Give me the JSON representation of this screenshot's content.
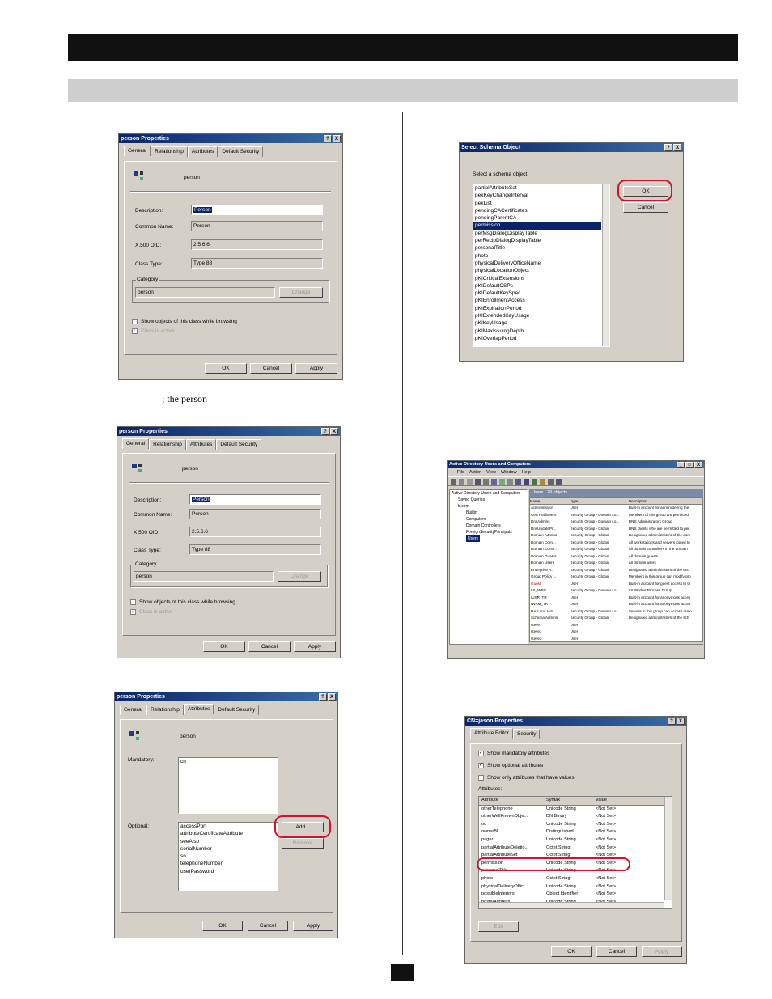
{
  "caption": "; the person",
  "dialog1": {
    "title": "person Properties",
    "title_buttons": [
      "?",
      "X"
    ],
    "tabs": [
      "General",
      "Relationship",
      "Attributes",
      "Default Security"
    ],
    "class_name": "person",
    "description_label": "Description:",
    "description_value": "Person",
    "common_name_label": "Common Name:",
    "common_name_value": "Person",
    "oid_label": "X.500 OID:",
    "oid_value": "2.5.6.6",
    "class_type_label": "Class Type:",
    "class_type_value": "Type 88",
    "category_label": "Category",
    "category_value": "person",
    "change_label": "Change",
    "show_objects_label": "Show objects of this class while browsing",
    "class_active_label": "Class is active",
    "ok_label": "OK",
    "cancel_label": "Cancel",
    "apply_label": "Apply"
  },
  "dialog3": {
    "title": "person Properties",
    "title_buttons": [
      "?",
      "X"
    ],
    "tabs": [
      "General",
      "Relationship",
      "Attributes",
      "Default Security"
    ],
    "class_name": "person",
    "mandatory_label": "Mandatory:",
    "mandatory_items": [
      "cn"
    ],
    "optional_label": "Optional:",
    "optional_items": [
      "accessPort",
      "attributeCertificateAttribute",
      "seeAlso",
      "serialNumber",
      "sn",
      "telephoneNumber",
      "userPassword"
    ],
    "add_label": "Add...",
    "remove_label": "Remove",
    "ok_label": "OK",
    "cancel_label": "Cancel",
    "apply_label": "Apply"
  },
  "schema_dialog": {
    "title": "Select Schema Object",
    "title_buttons": [
      "?",
      "X"
    ],
    "prompt": "Select a schema object:",
    "items": [
      "partialAttributeSet",
      "pekKeyChangeInterval",
      "pekList",
      "pendingCACertificates",
      "pendingParentCA",
      "permission",
      "perMsgDialogDisplayTable",
      "perRecipDialogDisplayTable",
      "personalTitle",
      "photo",
      "physicalDeliveryOfficeName",
      "physicalLocationObject",
      "pKICriticalExtensions",
      "pKIDefaultCSPs",
      "pKIDefaultKeySpec",
      "pKIEnrollmentAccess",
      "pKIExpirationPeriod",
      "pKIExtendedKeyUsage",
      "pKIKeyUsage",
      "pKIMaxIssuingDepth",
      "pKIOverlapPeriod"
    ],
    "selected": "permission",
    "ok_label": "OK",
    "cancel_label": "Cancel"
  },
  "aduc": {
    "title": "Active Directory Users and Computers",
    "title_buttons": [
      "_",
      "□",
      "X"
    ],
    "menu": [
      "File",
      "Action",
      "View",
      "Window",
      "Help"
    ],
    "tree": [
      "Active Directory Users and Computers",
      "Saved Queries",
      "tr.com",
      "Builtin",
      "Computers",
      "Domain Controllers",
      "ForeignSecurityPrincipals",
      "Users"
    ],
    "pane_header": "Users",
    "pane_count": "28 objects",
    "columns": [
      "Name",
      "Type",
      "Description"
    ],
    "rows": [
      [
        "Administrator",
        "User",
        "Built-in account for administering the"
      ],
      [
        "Cert Publishers",
        "Security Group - Domain Lo...",
        "Members of this group are permitted"
      ],
      [
        "DnsAdmins",
        "Security Group - Domain Lo...",
        "DNS Administrators Group"
      ],
      [
        "DnsUpdatePr...",
        "Security Group - Global",
        "DNS clients who are permitted to per"
      ],
      [
        "Domain Admins",
        "Security Group - Global",
        "Designated administrators of the dom"
      ],
      [
        "Domain Com...",
        "Security Group - Global",
        "All workstations and servers joined to"
      ],
      [
        "Domain Contr...",
        "Security Group - Global",
        "All domain controllers in the domain"
      ],
      [
        "Domain Guests",
        "Security Group - Global",
        "All domain guests"
      ],
      [
        "Domain Users",
        "Security Group - Global",
        "All domain users"
      ],
      [
        "Enterprise A...",
        "Security Group - Global",
        "Designated administrators of the ent"
      ],
      [
        "Group Policy ...",
        "Security Group - Global",
        "Members in this group can modify gro"
      ],
      [
        "Guest",
        "User",
        "Built-in account for guest access to th"
      ],
      [
        "IIS_WPG",
        "Security Group - Domain Lo...",
        "IIS Worker Process Group"
      ],
      [
        "IUSR_TR",
        "User",
        "Built-in account for anonymous acces"
      ],
      [
        "IWAM_TR",
        "User",
        "Built-in account for anonymous acces"
      ],
      [
        "RAS and IAS ...",
        "Security Group - Domain Lo...",
        "Servers in this group can access remo"
      ],
      [
        "Schema Admins",
        "Security Group - Global",
        "Designated administrators of the sch"
      ],
      [
        "steve",
        "User",
        ""
      ],
      [
        "steve1",
        "User",
        ""
      ],
      [
        "steve2",
        "User",
        ""
      ]
    ]
  },
  "jason": {
    "title": "CN=jason Properties",
    "title_buttons": [
      "?",
      "X"
    ],
    "tabs": [
      "Attribute Editor",
      "Security"
    ],
    "show_mandatory": "Show mandatory attributes",
    "show_optional": "Show optional attributes",
    "show_only_values": "Show only attributes that have values",
    "attributes_label": "Attributes:",
    "columns": [
      "Attribute",
      "Syntax",
      "Value"
    ],
    "rows": [
      [
        "otherTelephone",
        "Unicode String",
        "<Not Set>"
      ],
      [
        "otherWellKnownObje...",
        "DN Binary",
        "<Not Set>"
      ],
      [
        "ou",
        "Unicode String",
        "<Not Set>"
      ],
      [
        "ownerBL",
        "Distinguished ...",
        "<Not Set>"
      ],
      [
        "pager",
        "Unicode String",
        "<Not Set>"
      ],
      [
        "partialAttributeDeletio...",
        "Octet String",
        "<Not Set>"
      ],
      [
        "partialAttributeSet",
        "Octet String",
        "<Not Set>"
      ],
      [
        "permission",
        "Unicode String",
        "<Not Set>"
      ],
      [
        "personalTitle",
        "Unicode String",
        "<Not Set>"
      ],
      [
        "photo",
        "Octet String",
        "<Not Set>"
      ],
      [
        "physicalDeliveryOffic...",
        "Unicode String",
        "<Not Set>"
      ],
      [
        "possibleInferiors",
        "Object Identifier",
        "<Not Set>"
      ],
      [
        "postalAddress",
        "Unicode String",
        "<Not Set>"
      ]
    ],
    "edit_label": "Edit",
    "ok_label": "OK",
    "cancel_label": "Cancel",
    "apply_label": "Apply"
  }
}
